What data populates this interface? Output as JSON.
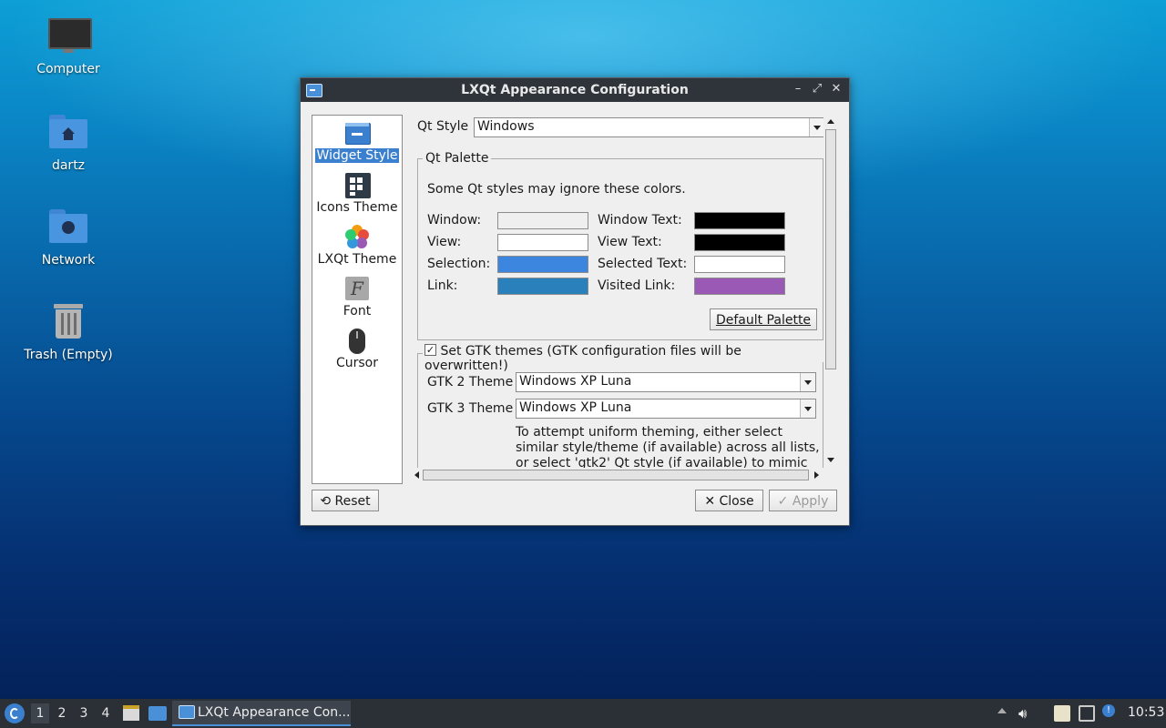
{
  "desktop": {
    "icons": [
      {
        "label": "Computer",
        "icon": "computer-icon"
      },
      {
        "label": "dartz",
        "icon": "home-folder-icon"
      },
      {
        "label": "Network",
        "icon": "network-folder-icon"
      },
      {
        "label": "Trash (Empty)",
        "icon": "trash-icon"
      }
    ]
  },
  "window": {
    "title": "LXQt Appearance Configuration",
    "controls": {
      "minimize": "–",
      "maximize": "⤢",
      "close": "✕"
    },
    "sidebar": {
      "items": [
        {
          "label": "Widget Style",
          "icon": "widget-style-icon",
          "selected": true
        },
        {
          "label": "Icons Theme",
          "icon": "icons-theme-icon"
        },
        {
          "label": "LXQt Theme",
          "icon": "lxqt-theme-icon"
        },
        {
          "label": "Font",
          "icon": "font-icon"
        },
        {
          "label": "Cursor",
          "icon": "cursor-icon"
        }
      ]
    },
    "qt_style": {
      "label": "Qt Style",
      "value": "Windows"
    },
    "palette": {
      "title": "Qt Palette",
      "note": "Some Qt styles may ignore these colors.",
      "rows": [
        {
          "left_label": "Window:",
          "left_color": "#efefef",
          "right_label": "Window Text:",
          "right_color": "#000000"
        },
        {
          "left_label": "View:",
          "left_color": "#ffffff",
          "right_label": "View Text:",
          "right_color": "#000000"
        },
        {
          "left_label": "Selection:",
          "left_color": "#3d86e0",
          "right_label": "Selected Text:",
          "right_color": "#ffffff"
        },
        {
          "left_label": "Link:",
          "left_color": "#2a80ba",
          "right_label": "Visited Link:",
          "right_color": "#9b59b6"
        }
      ],
      "default_button": "Default Palette"
    },
    "gtk": {
      "checkbox_label": "Set GTK themes (GTK configuration files will be overwritten!)",
      "checked": true,
      "gtk2_label": "GTK 2 Theme",
      "gtk2_value": "Windows XP Luna",
      "gtk3_label": "GTK 3 Theme",
      "gtk3_value": "Windows XP Luna",
      "hint_line1": "To attempt uniform theming, either select",
      "hint_line2": "similar style/theme (if available) across all lists,",
      "hint_line3": "or select 'gtk2' Qt style (if available) to mimic"
    },
    "buttons": {
      "reset": "Reset",
      "close": "Close",
      "apply": "Apply"
    }
  },
  "taskbar": {
    "workspaces": [
      "1",
      "2",
      "3",
      "4"
    ],
    "active_workspace": "1",
    "task_label": "LXQt Appearance Con...",
    "clock": "10:53"
  }
}
